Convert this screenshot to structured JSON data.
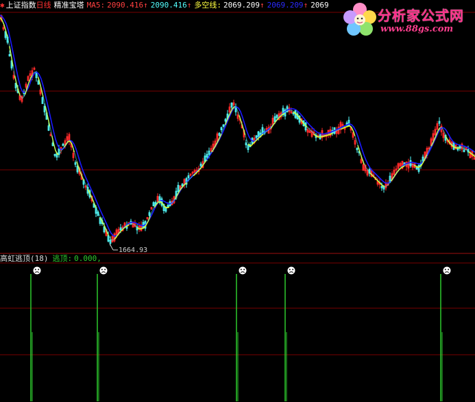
{
  "header": {
    "title_index": "上证指数",
    "title_period": "日线",
    "title_indicator": "精准宝塔",
    "ma5_label": "MA5:",
    "ma5_value1": "2090.416",
    "ma5_value2": "2090.416",
    "duokong_label": "多空线:",
    "duokong_value": "2069.209",
    "extra_value": "2069.209",
    "extra_value2": "2069"
  },
  "chart": {
    "low_label": "1664.93",
    "low_value": 1664.93
  },
  "sub_panel": {
    "indicator_name": "高虹逃顶",
    "indicator_param": "(18)",
    "output_label": "逃顶:",
    "output_value": "0.000,"
  },
  "logo": {
    "text_cn": "分析家公式网",
    "text_url": "www.88gs.com"
  },
  "colors": {
    "background": "#000000",
    "grid": "#7a0000",
    "up_candle": "#ff2a2a",
    "down_candle": "#54ffff",
    "ma_line": "#ffff00",
    "ma_line2": "#1a1aff",
    "signal_line": "#2ecc2e"
  },
  "icons": {
    "signal": "frown-face-icon",
    "arrow": "up-arrow-icon"
  },
  "signals": [
    {
      "x_index": 45,
      "value": 1
    },
    {
      "x_index": 142,
      "value": 1
    },
    {
      "x_index": 345,
      "value": 1
    },
    {
      "x_index": 416,
      "value": 1
    },
    {
      "x_index": 643,
      "value": 1
    }
  ]
}
